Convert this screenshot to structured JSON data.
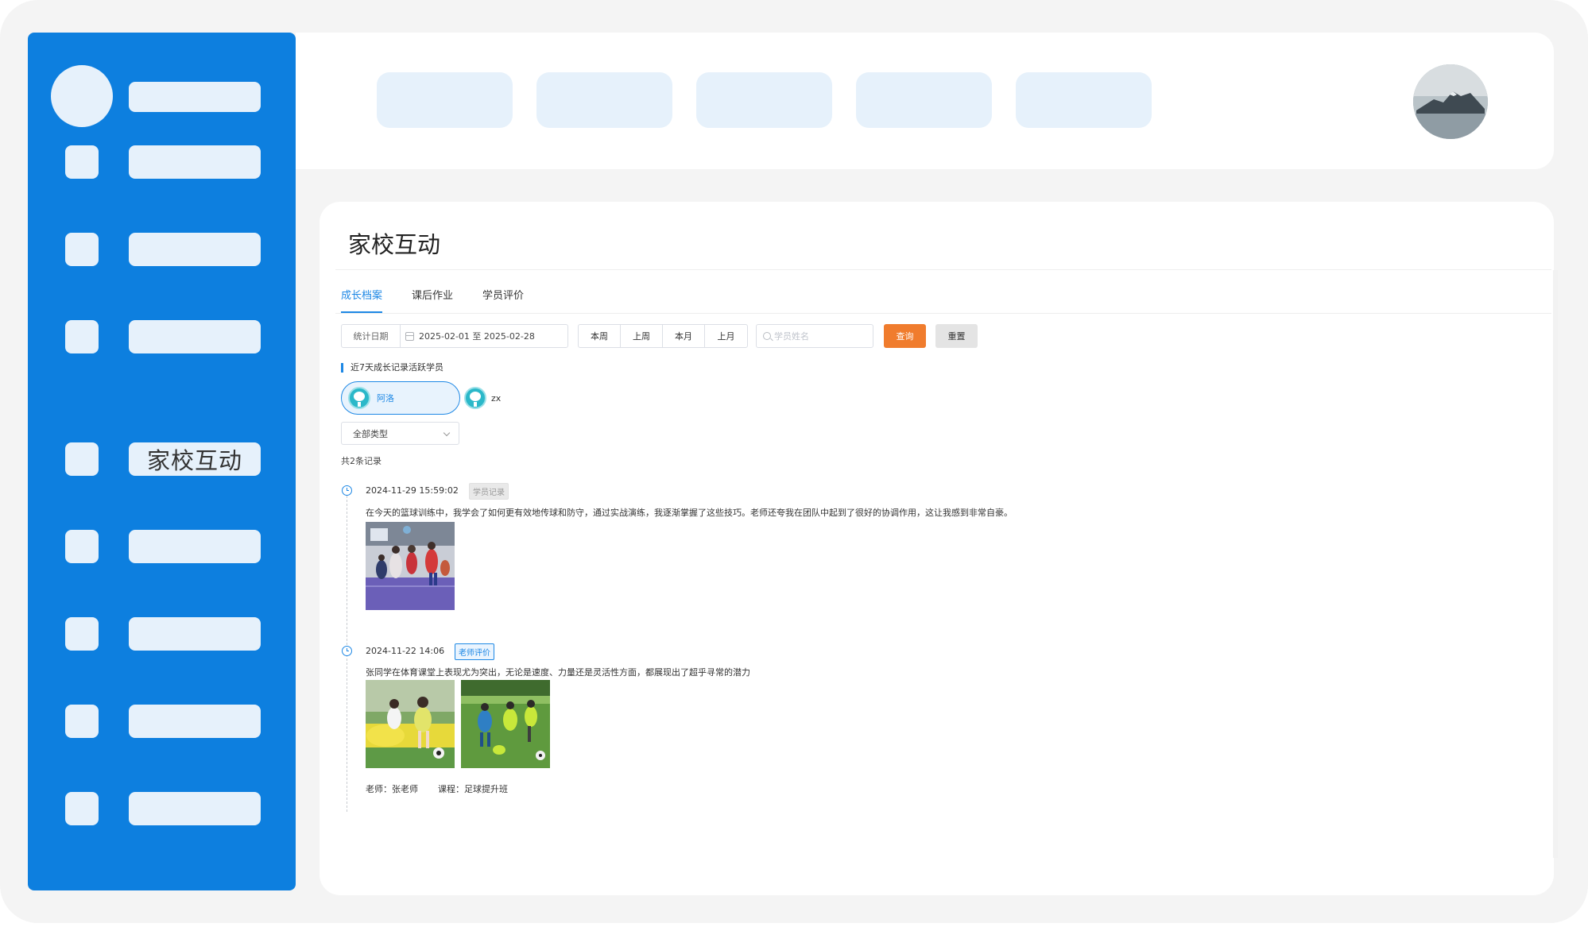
{
  "sidebar": {
    "active_label": "家校互动"
  },
  "page": {
    "title": "家校互动"
  },
  "tabs": [
    {
      "label": "成长档案",
      "active": true
    },
    {
      "label": "课后作业",
      "active": false
    },
    {
      "label": "学员评价",
      "active": false
    }
  ],
  "filter": {
    "date_label": "统计日期",
    "date_range": "2025-02-01 至 2025-02-28",
    "quick_ranges": [
      "本周",
      "上周",
      "本月",
      "上月"
    ],
    "search_placeholder": "学员姓名",
    "query_label": "查询",
    "reset_label": "重置"
  },
  "active_students": {
    "heading": "近7天成长记录活跃学员",
    "students": [
      {
        "name": "阿洛",
        "selected": true
      },
      {
        "name": "zx",
        "selected": false
      }
    ]
  },
  "type_select": {
    "value": "全部类型"
  },
  "records_count": "共2条记录",
  "records": [
    {
      "time": "2024-11-29 15:59:02",
      "tag": "学员记录",
      "text": "在今天的篮球训练中，我学会了如何更有效地传球和防守，通过实战演练，我逐渐掌握了这些技巧。老师还夸我在团队中起到了很好的协调作用，这让我感到非常自豪。"
    },
    {
      "time": "2024-11-22 14:06",
      "tag": "老师评价",
      "text": "张同学在体育课堂上表现尤为突出，无论是速度、力量还是灵活性方面，都展现出了超乎寻常的潜力",
      "teacher": "老师：张老师",
      "course": "课程：足球提升班"
    }
  ],
  "colors": {
    "sidebar": "#0d7fdf",
    "accent": "#1e88e5",
    "query_button": "#f07c2d",
    "placeholder_block": "#e6f1fb"
  }
}
